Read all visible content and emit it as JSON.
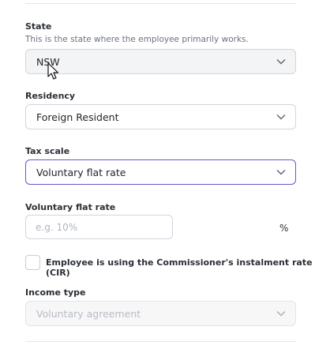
{
  "state": {
    "label": "State",
    "help": "This is the state where the employee primarily works.",
    "value": "NSW"
  },
  "residency": {
    "label": "Residency",
    "value": "Foreign Resident"
  },
  "tax_scale": {
    "label": "Tax scale",
    "value": "Voluntary flat rate"
  },
  "voluntary_flat_rate": {
    "label": "Voluntary flat rate",
    "placeholder": "e.g. 10%",
    "unit": "%"
  },
  "cir_checkbox": {
    "label": "Employee is using the Commissioner's instalment rate (CIR)",
    "checked": false
  },
  "income_type": {
    "label": "Income type",
    "value": "Voluntary agreement",
    "disabled": true
  },
  "icons": {
    "select_arrow": "chevron-down-icon",
    "pointer": "mouse-pointer-icon"
  },
  "colors": {
    "focus_border": "#6d4fd1",
    "muted_field": "#f3f4f6"
  }
}
